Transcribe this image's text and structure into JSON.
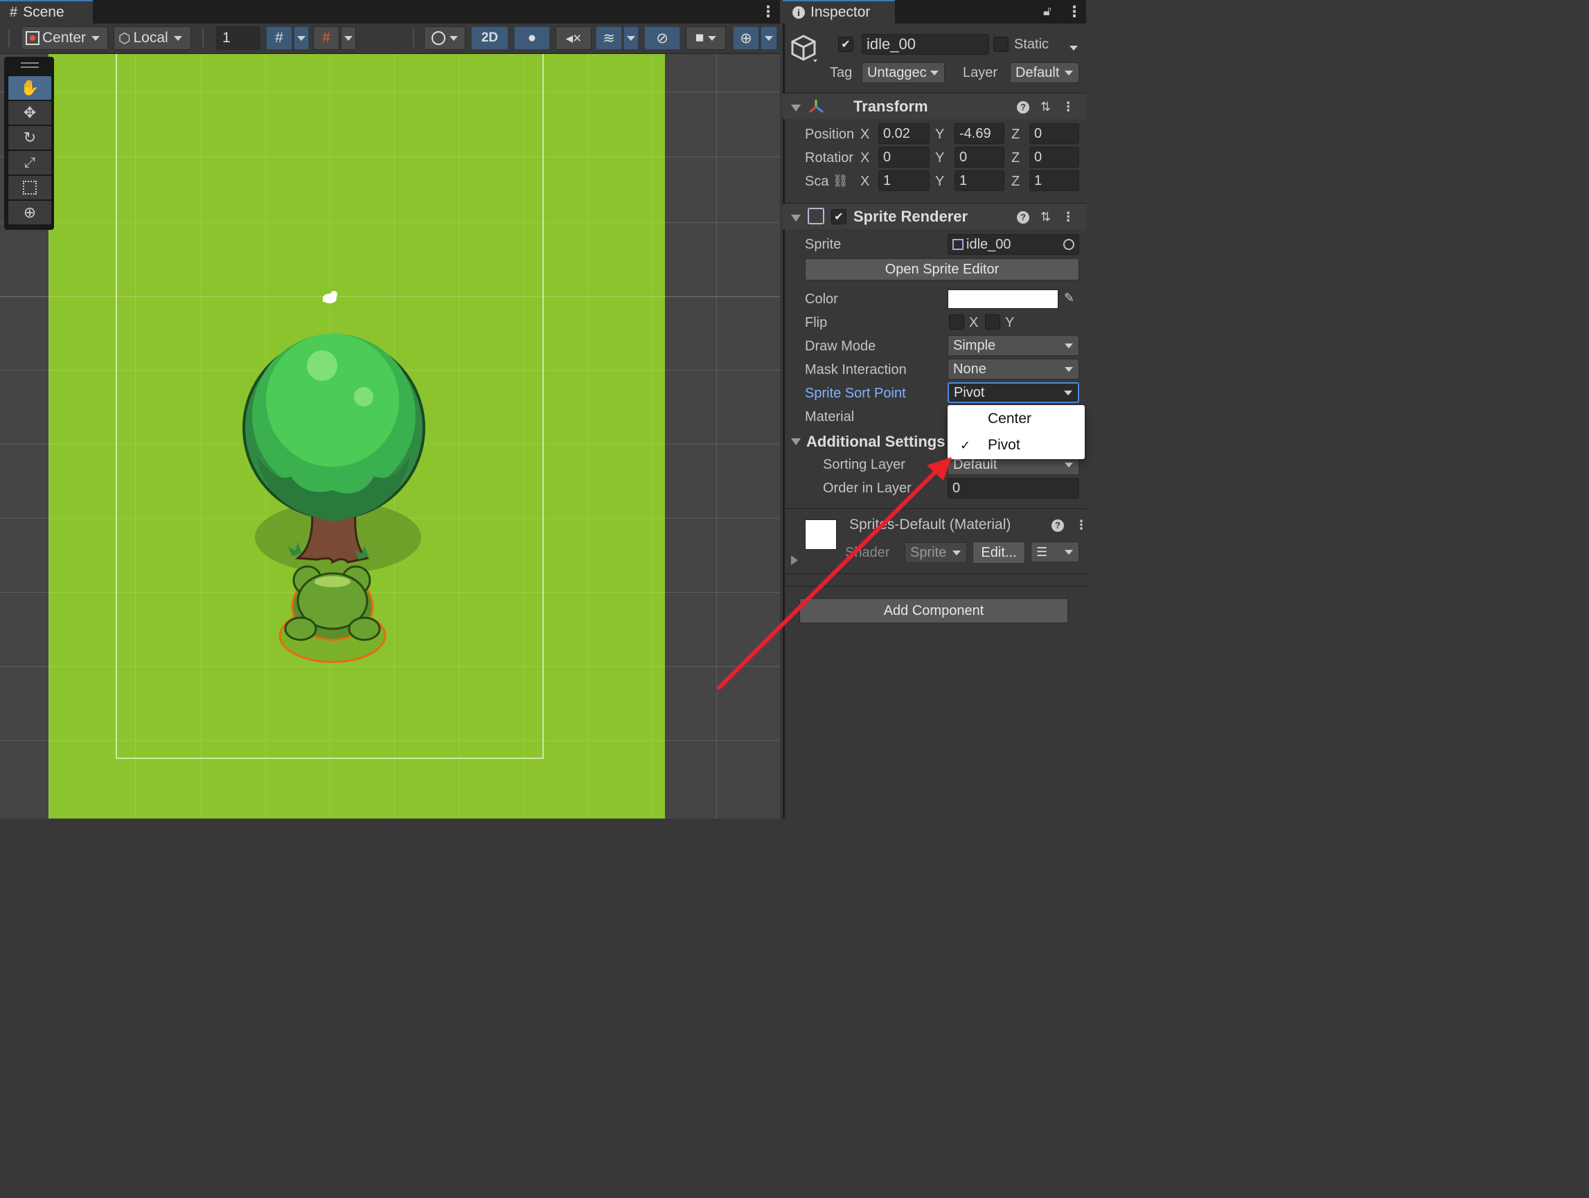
{
  "scene": {
    "tab_label": "Scene",
    "toolbar": {
      "pivot_mode": "Center",
      "space_mode": "Local",
      "grid_size": "1",
      "mode_2d": "2D"
    }
  },
  "inspector": {
    "tab_label": "Inspector",
    "object": {
      "name": "idle_00",
      "active": true,
      "static_label": "Static",
      "tag_label": "Tag",
      "tag_value": "Untaggec",
      "layer_label": "Layer",
      "layer_value": "Default"
    },
    "transform": {
      "title": "Transform",
      "position_label": "Position",
      "rotation_label": "Rotatior",
      "scale_label": "Sca",
      "axis_x": "X",
      "axis_y": "Y",
      "axis_z": "Z",
      "position": {
        "x": "0.02",
        "y": "-4.69",
        "z": "0"
      },
      "rotation": {
        "x": "0",
        "y": "0",
        "z": "0"
      },
      "scale": {
        "x": "1",
        "y": "1",
        "z": "1"
      }
    },
    "sprite_renderer": {
      "title": "Sprite Renderer",
      "enabled": true,
      "sprite_label": "Sprite",
      "sprite_value": "idle_00",
      "open_editor_label": "Open Sprite Editor",
      "color_label": "Color",
      "color_value": "#ffffff",
      "flip_label": "Flip",
      "flip_x": "X",
      "flip_y": "Y",
      "draw_mode_label": "Draw Mode",
      "draw_mode_value": "Simple",
      "mask_label": "Mask Interaction",
      "mask_value": "None",
      "sort_point_label": "Sprite Sort Point",
      "sort_point_value": "Pivot",
      "material_label": "Material",
      "additional_settings_label": "Additional Settings",
      "sorting_layer_label": "Sorting Layer",
      "sorting_layer_value": "Default",
      "order_label": "Order in Layer",
      "order_value": "0"
    },
    "material": {
      "name": "Sprites-Default (Material)",
      "shader_label": "Shader",
      "shader_value": "Sprite",
      "edit_label": "Edit..."
    },
    "add_component_label": "Add Component",
    "sort_point_popup": {
      "options": [
        "Center",
        "Pivot"
      ],
      "selected": "Pivot",
      "check": "✓"
    }
  },
  "colors": {
    "accent": "#3a79bb",
    "ground": "#8cc42e",
    "highlight_label": "#7fb2ff",
    "arrow": "#e8202a"
  }
}
